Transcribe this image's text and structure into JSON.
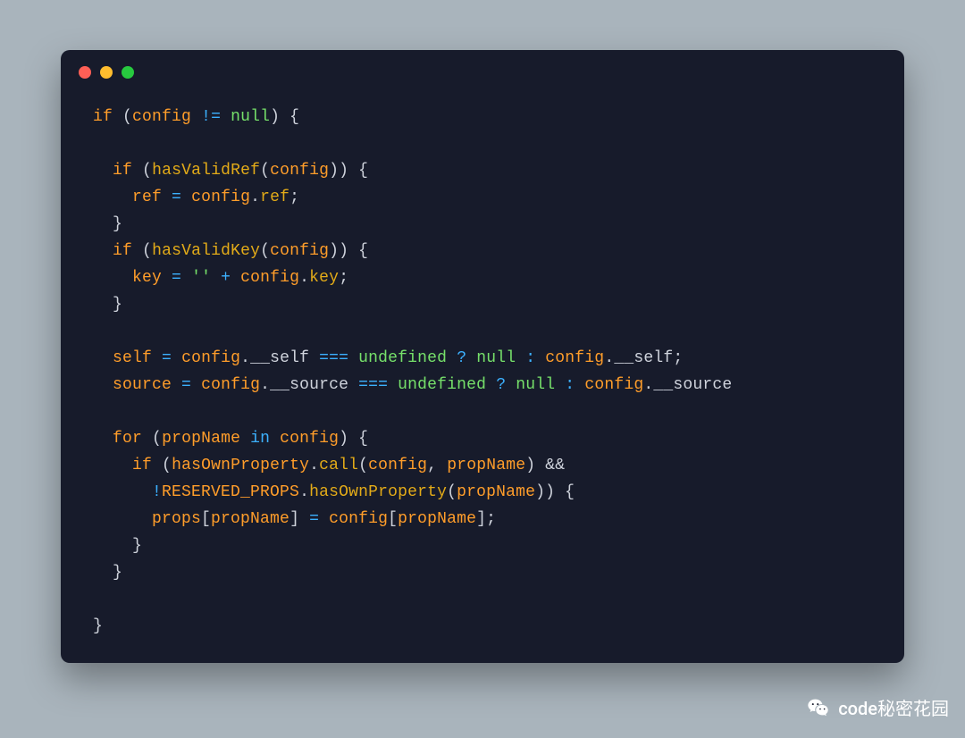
{
  "watermark": {
    "text": "code秘密花园"
  },
  "code": {
    "l1": {
      "t0": "if",
      "t1": "(",
      "t2": "config",
      "t3": "!=",
      "t4": "null",
      "t5": ") {"
    },
    "l3": {
      "t0": "if",
      "t1": "(",
      "t2": "hasValidRef",
      "t3": "(",
      "t4": "config",
      "t5": ")) {"
    },
    "l4": {
      "t0": "ref",
      "t1": "=",
      "t2": "config",
      "t3": ".",
      "t4": "ref",
      "t5": ";"
    },
    "l5": {
      "t0": "}"
    },
    "l6": {
      "t0": "if",
      "t1": "(",
      "t2": "hasValidKey",
      "t3": "(",
      "t4": "config",
      "t5": ")) {"
    },
    "l7": {
      "t0": "key",
      "t1": "=",
      "t2": "''",
      "t3": "+",
      "t4": "config",
      "t5": ".",
      "t6": "key",
      "t7": ";"
    },
    "l8": {
      "t0": "}"
    },
    "l10": {
      "t0": "self",
      "t1": "=",
      "t2": "config",
      "t3": ".__self",
      "t4": "===",
      "t5": "undefined",
      "t6": "?",
      "t7": "null",
      "t8": ":",
      "t9": "config",
      "t10": ".__self;"
    },
    "l11": {
      "t0": "source",
      "t1": "=",
      "t2": "config",
      "t3": ".__source",
      "t4": "===",
      "t5": "undefined",
      "t6": "?",
      "t7": "null",
      "t8": ":",
      "t9": "config",
      "t10": ".__source"
    },
    "l13": {
      "t0": "for",
      "t1": "(",
      "t2": "propName",
      "t3": "in",
      "t4": "config",
      "t5": ") {"
    },
    "l14": {
      "t0": "if",
      "t1": "(",
      "t2": "hasOwnProperty",
      "t3": ".",
      "t4": "call",
      "t5": "(",
      "t6": "config",
      "t7": ",",
      "t8": "propName",
      "t9": ") &&"
    },
    "l15": {
      "t0": "!",
      "t1": "RESERVED_PROPS",
      "t2": ".",
      "t3": "hasOwnProperty",
      "t4": "(",
      "t5": "propName",
      "t6": ")) {"
    },
    "l16": {
      "t0": "props",
      "t1": "[",
      "t2": "propName",
      "t3": "]",
      "t4": "=",
      "t5": "config",
      "t6": "[",
      "t7": "propName",
      "t8": "];"
    },
    "l17": {
      "t0": "}"
    },
    "l18": {
      "t0": "}"
    },
    "l20": {
      "t0": "}"
    }
  }
}
